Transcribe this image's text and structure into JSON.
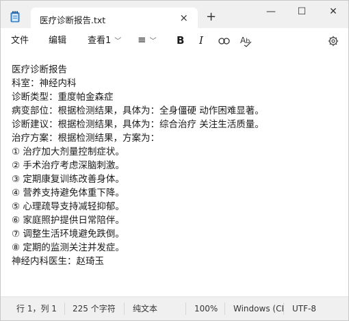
{
  "tab": {
    "title": "医疗诊断报告.txt",
    "close": "×"
  },
  "window_controls": {
    "new_tab": "+",
    "minimize": "—",
    "maximize": "☐",
    "close": "✕"
  },
  "menu": {
    "file": "文件",
    "edit": "编辑",
    "view": "查看1",
    "list_icon": "≡",
    "bold": "B",
    "italic": "I",
    "link_icon": "link-icon",
    "spellcheck_icon": "spellcheck-icon",
    "settings_icon": "gear-icon"
  },
  "document": {
    "lines": [
      "医疗诊断报告",
      "科室：神经内科",
      "诊断类型：重度帕金森症",
      "病变部位：根据检测结果，具体为：全身僵硬 动作困难显著。",
      "诊断建议：根据检测结果，具体为：综合治疗 关注生活质量。",
      "治疗方案：根据检测结果，方案为：",
      "① 治疗加大剂量控制症状。",
      "② 手术治疗考虑深脑刺激。",
      "③ 定期康复训练改善身体。",
      "④ 营养支持避免体重下降。",
      "⑤ 心理疏导支持减轻抑郁。",
      "⑥ 家庭照护提供日常陪伴。",
      "⑦ 调整生活环境避免跌倒。",
      "⑧ 定期的监测关注并发症。",
      "神经内科医生：赵琦玉"
    ]
  },
  "status": {
    "position": "行 1，列 1",
    "chars": "225 个字符",
    "format": "纯文本",
    "zoom": "100%",
    "line_ending": "Windows (CI",
    "encoding": "UTF-8"
  }
}
